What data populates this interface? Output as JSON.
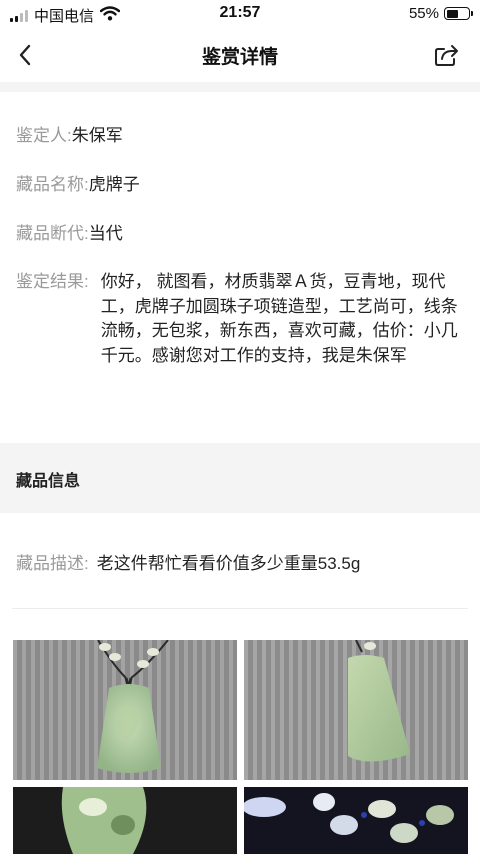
{
  "status_bar": {
    "carrier": "中国电信",
    "time": "21:57",
    "battery_percent": "55%",
    "battery_level": 0.55,
    "icons": [
      "signal-icon",
      "wifi-icon",
      "battery-icon"
    ]
  },
  "nav": {
    "title": "鉴赏详情",
    "icons": [
      "back-arrow-icon",
      "share-icon"
    ]
  },
  "appraisal": {
    "appraiser_label": "鉴定人:",
    "appraiser": "朱保军",
    "item_name_label": "藏品名称:",
    "item_name": "虎牌子",
    "era_label": "藏品断代:",
    "era": "当代",
    "result_label": "鉴定结果:",
    "result": "你好，  就图看，材质翡翠Ａ货，豆青地，现代工，虎牌子加圆珠子项链造型，工艺尚可，线条流畅，无包浆，新东西，喜欢可藏，估价：小几千元。感谢您对工作的支持，我是朱保军"
  },
  "collection": {
    "section_title": "藏品信息",
    "description_label": "藏品描述:",
    "description": "老这件帮忙看看价值多少重量53.5g"
  },
  "colors": {
    "label_gray": "#9a9a9a",
    "band_gray": "#f4f4f4",
    "jade_green": "#a9c79a"
  }
}
